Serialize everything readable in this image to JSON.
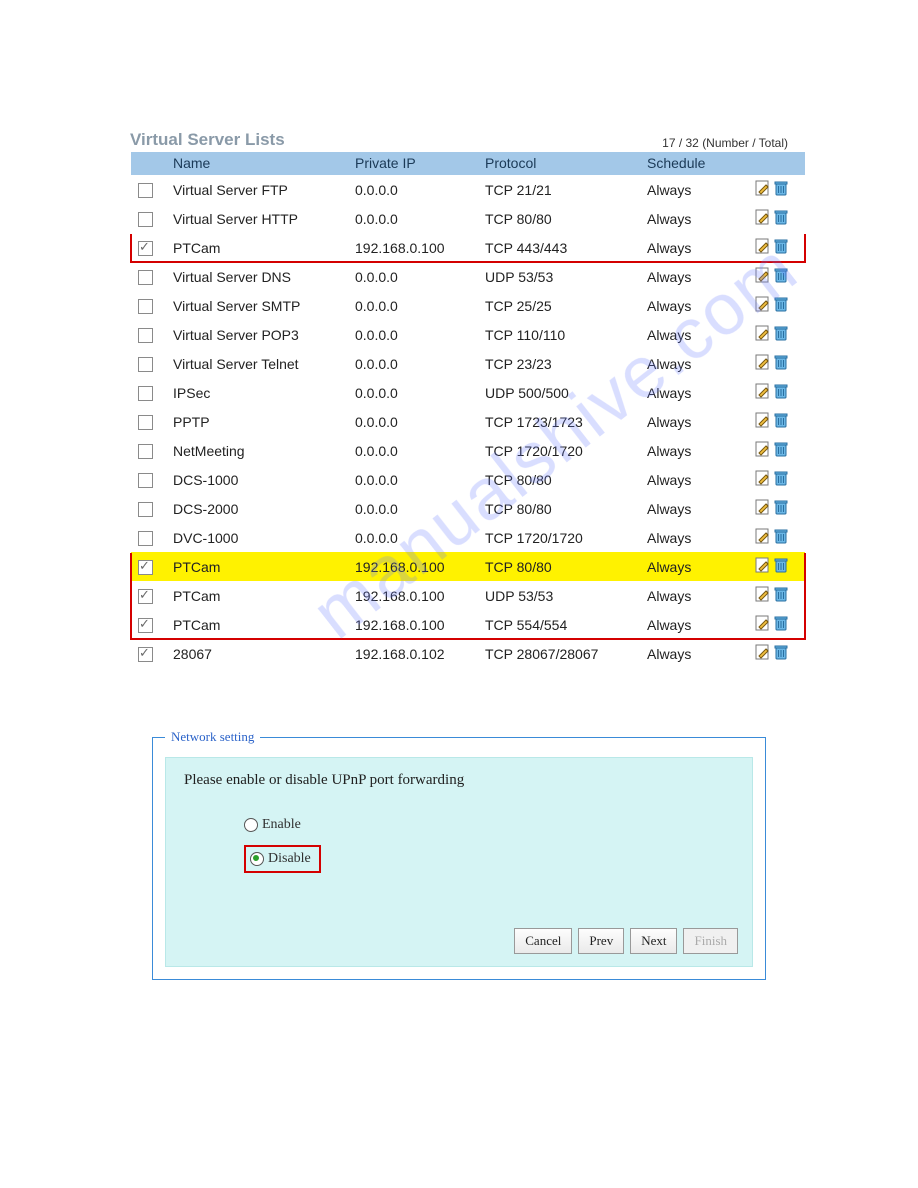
{
  "watermark": "manualshive.com",
  "vsl": {
    "title": "Virtual Server Lists",
    "count_label": "17 / 32 (Number / Total)",
    "headers": {
      "name": "Name",
      "private_ip": "Private IP",
      "protocol": "Protocol",
      "schedule": "Schedule"
    },
    "rows": [
      {
        "checked": false,
        "name": "Virtual Server FTP",
        "ip": "0.0.0.0",
        "proto": "TCP 21/21",
        "sched": "Always",
        "box": "",
        "hl": false
      },
      {
        "checked": false,
        "name": "Virtual Server HTTP",
        "ip": "0.0.0.0",
        "proto": "TCP 80/80",
        "sched": "Always",
        "box": "",
        "hl": false
      },
      {
        "checked": true,
        "name": "PTCam",
        "ip": "192.168.0.100",
        "proto": "TCP 443/443",
        "sched": "Always",
        "box": "single",
        "hl": false
      },
      {
        "checked": false,
        "name": "Virtual Server DNS",
        "ip": "0.0.0.0",
        "proto": "UDP 53/53",
        "sched": "Always",
        "box": "",
        "hl": false
      },
      {
        "checked": false,
        "name": "Virtual Server SMTP",
        "ip": "0.0.0.0",
        "proto": "TCP 25/25",
        "sched": "Always",
        "box": "",
        "hl": false
      },
      {
        "checked": false,
        "name": "Virtual Server POP3",
        "ip": "0.0.0.0",
        "proto": "TCP 110/110",
        "sched": "Always",
        "box": "",
        "hl": false
      },
      {
        "checked": false,
        "name": "Virtual Server Telnet",
        "ip": "0.0.0.0",
        "proto": "TCP 23/23",
        "sched": "Always",
        "box": "",
        "hl": false
      },
      {
        "checked": false,
        "name": "IPSec",
        "ip": "0.0.0.0",
        "proto": "UDP 500/500",
        "sched": "Always",
        "box": "",
        "hl": false
      },
      {
        "checked": false,
        "name": "PPTP",
        "ip": "0.0.0.0",
        "proto": "TCP 1723/1723",
        "sched": "Always",
        "box": "",
        "hl": false
      },
      {
        "checked": false,
        "name": "NetMeeting",
        "ip": "0.0.0.0",
        "proto": "TCP 1720/1720",
        "sched": "Always",
        "box": "",
        "hl": false
      },
      {
        "checked": false,
        "name": "DCS-1000",
        "ip": "0.0.0.0",
        "proto": "TCP 80/80",
        "sched": "Always",
        "box": "",
        "hl": false
      },
      {
        "checked": false,
        "name": "DCS-2000",
        "ip": "0.0.0.0",
        "proto": "TCP 80/80",
        "sched": "Always",
        "box": "",
        "hl": false
      },
      {
        "checked": false,
        "name": "DVC-1000",
        "ip": "0.0.0.0",
        "proto": "TCP 1720/1720",
        "sched": "Always",
        "box": "",
        "hl": false
      },
      {
        "checked": true,
        "name": "PTCam",
        "ip": "192.168.0.100",
        "proto": "TCP 80/80",
        "sched": "Always",
        "box": "top",
        "hl": true
      },
      {
        "checked": true,
        "name": "PTCam",
        "ip": "192.168.0.100",
        "proto": "UDP 53/53",
        "sched": "Always",
        "box": "mid",
        "hl": false
      },
      {
        "checked": true,
        "name": "PTCam",
        "ip": "192.168.0.100",
        "proto": "TCP 554/554",
        "sched": "Always",
        "box": "bottom",
        "hl": false
      },
      {
        "checked": true,
        "name": "28067",
        "ip": "192.168.0.102",
        "proto": "TCP 28067/28067",
        "sched": "Always",
        "box": "",
        "hl": false
      }
    ]
  },
  "netset": {
    "legend": "Network setting",
    "prompt": "Please enable or disable UPnP port forwarding",
    "options": {
      "enable": "Enable",
      "disable": "Disable"
    },
    "selected": "disable",
    "buttons": {
      "cancel": "Cancel",
      "prev": "Prev",
      "next": "Next",
      "finish": "Finish"
    }
  }
}
